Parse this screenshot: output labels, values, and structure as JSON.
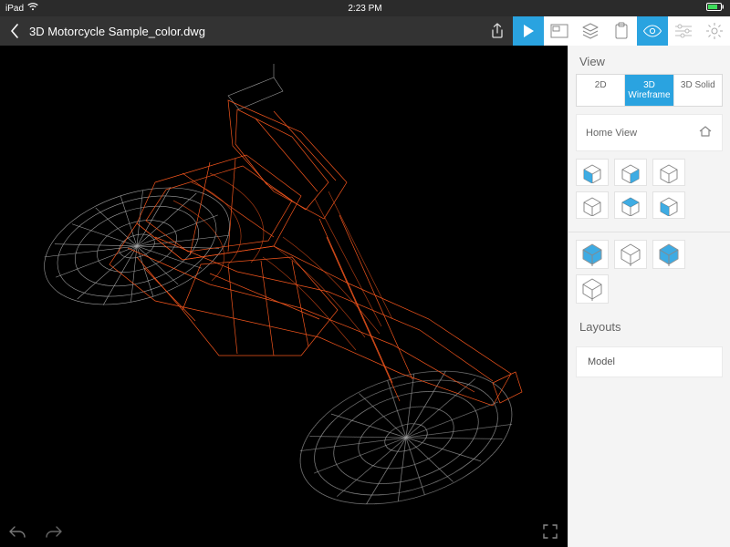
{
  "statusbar": {
    "device": "iPad",
    "time": "2:23 PM",
    "battery_pct": 75
  },
  "topbar": {
    "filename": "3D Motorcycle Sample_color.dwg",
    "icons": {
      "back": "chevron-left",
      "share": "share",
      "play": "play",
      "viewport": "viewport",
      "layers": "layers",
      "clipboard": "clipboard",
      "eye": "eye",
      "sliders": "sliders",
      "gear": "gear"
    }
  },
  "panel": {
    "view_title": "View",
    "modes": [
      "2D",
      "3D Wireframe",
      "3D Solid"
    ],
    "active_mode_index": 1,
    "home_view_label": "Home View",
    "cube_faces": [
      {
        "id": "front",
        "highlight": "front"
      },
      {
        "id": "front-right",
        "highlight": "right"
      },
      {
        "id": "right",
        "highlight": "none"
      },
      {
        "id": "back-right",
        "highlight": "none"
      },
      {
        "id": "front-top",
        "highlight": "top"
      },
      {
        "id": "front-left",
        "highlight": "front"
      }
    ],
    "hex_presets": [
      {
        "id": "iso-1",
        "fill": true
      },
      {
        "id": "iso-2",
        "fill": false
      },
      {
        "id": "iso-3",
        "fill": true
      },
      {
        "id": "iso-4",
        "fill": false
      }
    ],
    "layouts_title": "Layouts",
    "layouts": [
      "Model"
    ]
  },
  "colors": {
    "accent": "#2aa3e0",
    "wire_primary": "#ff5a1f",
    "wire_secondary": "#cccccc"
  }
}
